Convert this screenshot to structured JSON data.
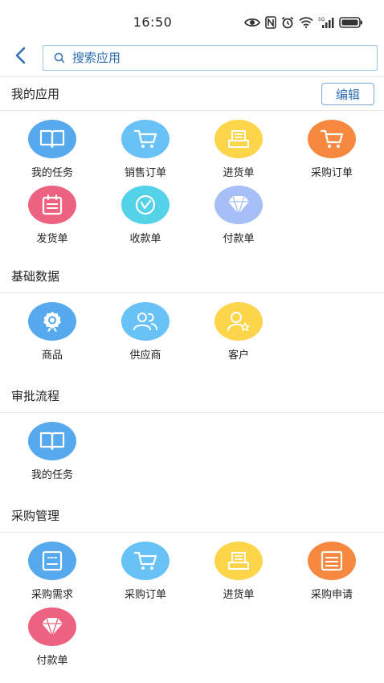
{
  "status_bar": {
    "time": "16:50"
  },
  "header": {
    "back_icon": "chevron-left-icon",
    "search_placeholder": "搜索应用"
  },
  "sections": [
    {
      "title": "我的应用",
      "edit_label": "编辑",
      "apps": [
        {
          "label": "我的任务",
          "icon": "book-icon",
          "color": "#55a9ec"
        },
        {
          "label": "销售订单",
          "icon": "cart-icon",
          "color": "#68c2f5"
        },
        {
          "label": "进货单",
          "icon": "tray-icon",
          "color": "#fdd54a"
        },
        {
          "label": "采购订单",
          "icon": "cart-icon",
          "color": "#f6883f"
        },
        {
          "label": "发货单",
          "icon": "calendar-icon",
          "color": "#ee6281"
        },
        {
          "label": "收款单",
          "icon": "clock-icon",
          "color": "#53d2e8"
        },
        {
          "label": "付款单",
          "icon": "diamond-icon",
          "color": "#a6bff7"
        }
      ]
    },
    {
      "title": "基础数据",
      "apps": [
        {
          "label": "商品",
          "icon": "award-icon",
          "color": "#55a9ec"
        },
        {
          "label": "供应商",
          "icon": "users-icon",
          "color": "#68c2f5"
        },
        {
          "label": "客户",
          "icon": "user-star-icon",
          "color": "#fdd54a"
        }
      ]
    },
    {
      "title": "审批流程",
      "apps": [
        {
          "label": "我的任务",
          "icon": "book-icon",
          "color": "#55a9ec"
        }
      ]
    },
    {
      "title": "采购管理",
      "apps": [
        {
          "label": "采购需求",
          "icon": "document-icon",
          "color": "#55a9ec"
        },
        {
          "label": "采购订单",
          "icon": "cart-icon",
          "color": "#68c2f5"
        },
        {
          "label": "进货单",
          "icon": "tray-icon",
          "color": "#fdd54a"
        },
        {
          "label": "采购申请",
          "icon": "form-icon",
          "color": "#f6883f"
        },
        {
          "label": "付款单",
          "icon": "diamond-icon",
          "color": "#ee6281"
        }
      ]
    }
  ]
}
